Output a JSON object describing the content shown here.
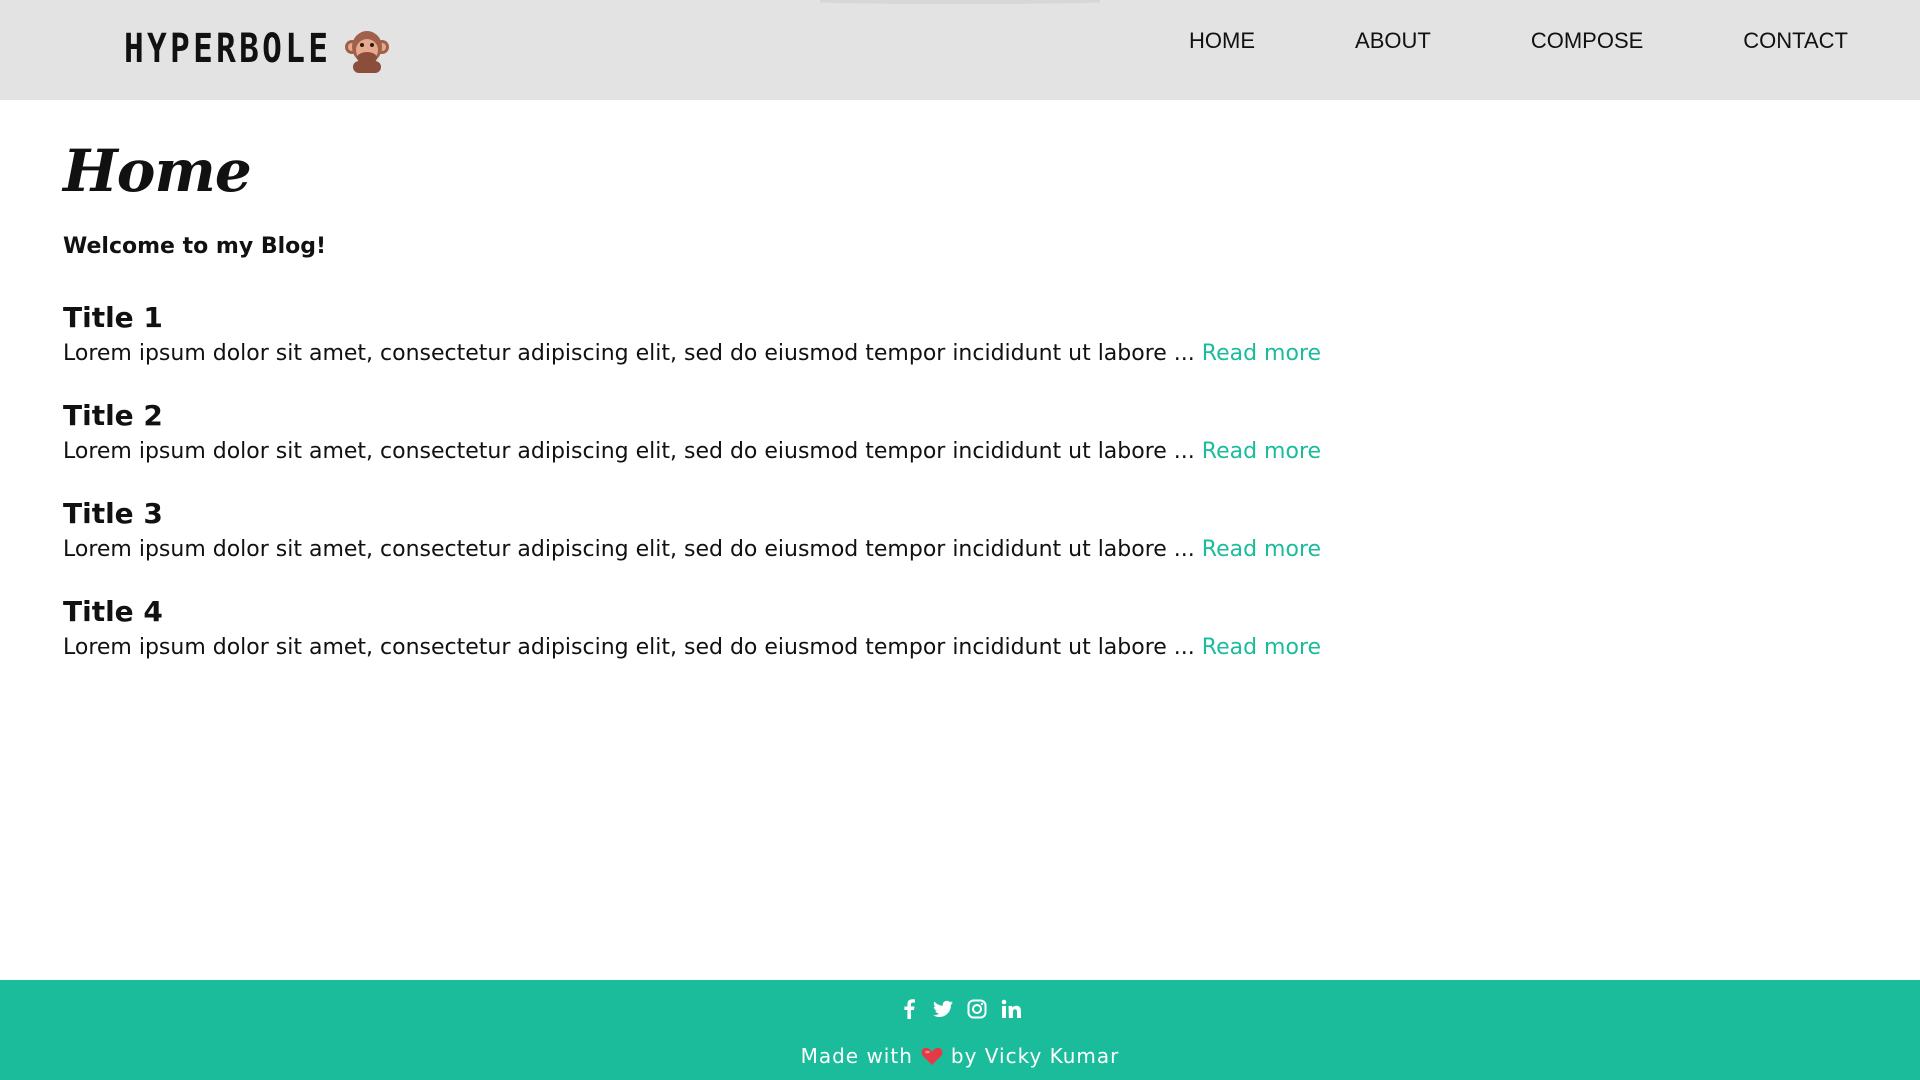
{
  "brand": {
    "name": "HYPERBOLE",
    "icon": "speak-no-evil-monkey-icon"
  },
  "nav": {
    "items": [
      {
        "label": "HOME"
      },
      {
        "label": "ABOUT"
      },
      {
        "label": "COMPOSE"
      },
      {
        "label": "CONTACT"
      }
    ]
  },
  "page": {
    "title": "Home",
    "welcome": "Welcome to my Blog!"
  },
  "posts": [
    {
      "title": "Title 1",
      "excerpt": "Lorem ipsum dolor sit amet, consectetur adipiscing elit, sed do eiusmod tempor incididunt ut labore ... ",
      "link": "Read more"
    },
    {
      "title": "Title 2",
      "excerpt": "Lorem ipsum dolor sit amet, consectetur adipiscing elit, sed do eiusmod tempor incididunt ut labore ... ",
      "link": "Read more"
    },
    {
      "title": "Title 3",
      "excerpt": "Lorem ipsum dolor sit amet, consectetur adipiscing elit, sed do eiusmod tempor incididunt ut labore ... ",
      "link": "Read more"
    },
    {
      "title": "Title 4",
      "excerpt": "Lorem ipsum dolor sit amet, consectetur adipiscing elit, sed do eiusmod tempor incididunt ut labore ... ",
      "link": "Read more"
    }
  ],
  "footer": {
    "socials": [
      "facebook-icon",
      "twitter-icon",
      "instagram-icon",
      "linkedin-icon"
    ],
    "made_with": "Made with",
    "heart_icon": "heart-icon",
    "by": "by Vicky Kumar"
  },
  "colors": {
    "accent": "#1abc9c",
    "navbar": "#e3e3e3",
    "text": "#111111"
  }
}
